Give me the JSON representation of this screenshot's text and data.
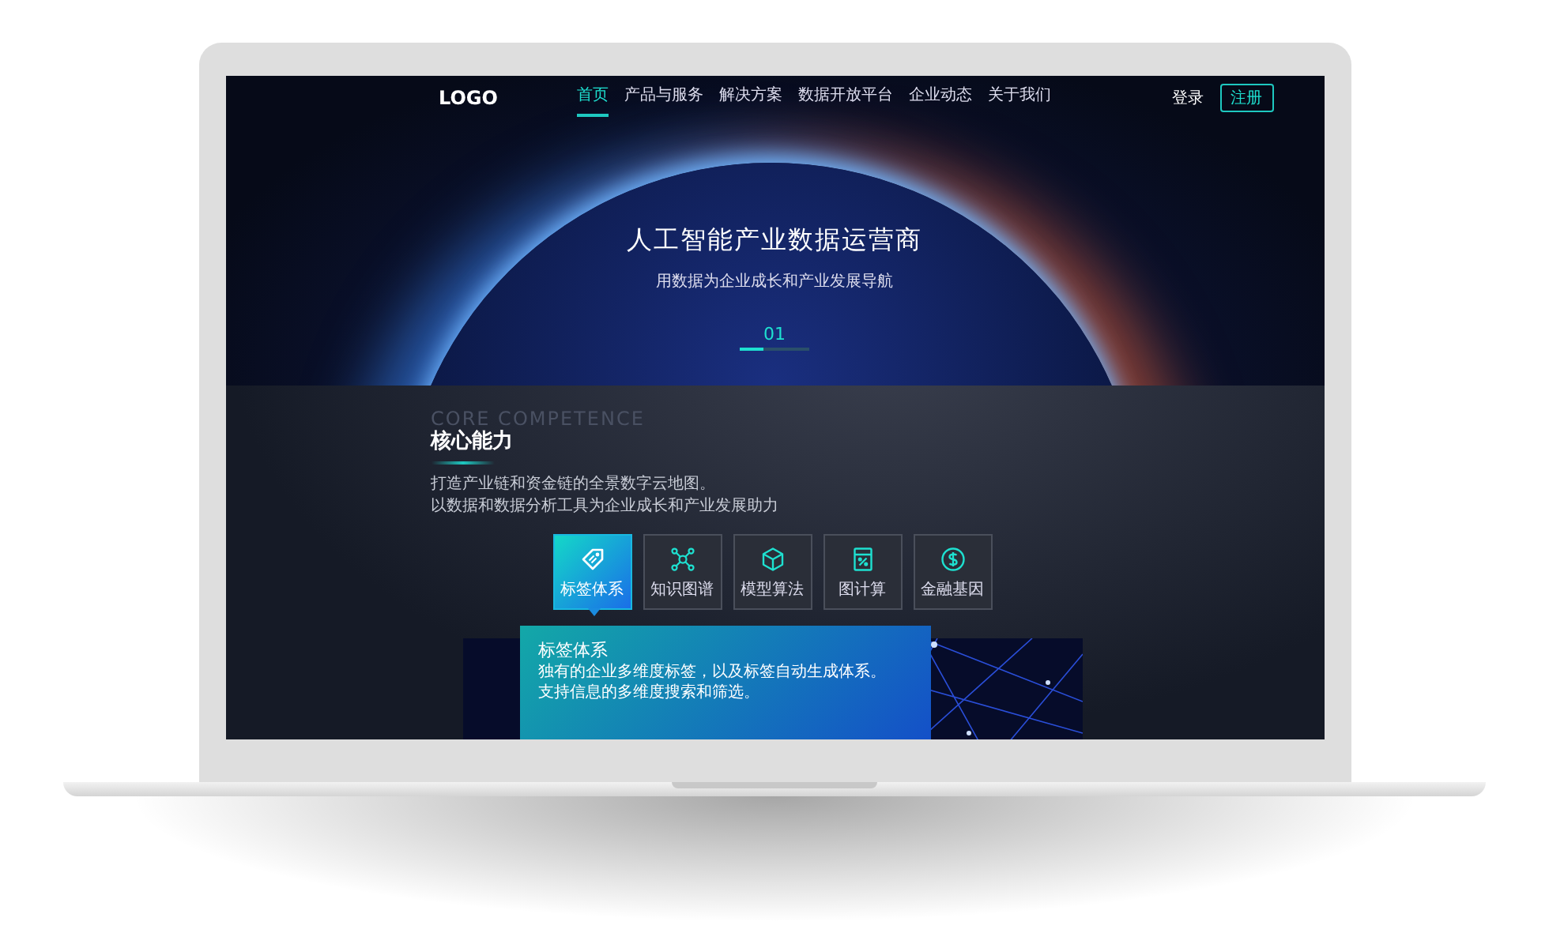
{
  "brand": {
    "logo": "LOGO"
  },
  "nav": [
    {
      "label": "首页",
      "selected": true
    },
    {
      "label": "产品与服务",
      "selected": false
    },
    {
      "label": "解决方案",
      "selected": false
    },
    {
      "label": "数据开放平台",
      "selected": false
    },
    {
      "label": "企业动态",
      "selected": false
    },
    {
      "label": "关于我们",
      "selected": false
    }
  ],
  "auth": {
    "login": "登录",
    "register": "注册"
  },
  "hero": {
    "title": "人工智能产业数据运营商",
    "subtitle": "用数据为企业成长和产业发展导航",
    "slide": {
      "number": "01",
      "level": 0.35
    }
  },
  "section": {
    "watermark": "CORE COMPETENCE",
    "title": "核心能力",
    "description": [
      "打造产业链和资金链的全景数字云地图。",
      "以数据和数据分析工具为企业成长和产业发展助力"
    ]
  },
  "features": [
    {
      "label": "标签体系",
      "kind": "tag",
      "selected": true
    },
    {
      "label": "知识图谱",
      "kind": "graph",
      "selected": false
    },
    {
      "label": "模型算法",
      "kind": "cube",
      "selected": false
    },
    {
      "label": "图计算",
      "kind": "calculator",
      "selected": false
    },
    {
      "label": "金融基因",
      "kind": "coin",
      "selected": false
    }
  ],
  "detail": {
    "title": "标签体系",
    "lines": [
      "独有的企业多维度标签，以及标签自动生成体系。",
      "支持信息的多维度搜索和筛选。"
    ]
  }
}
